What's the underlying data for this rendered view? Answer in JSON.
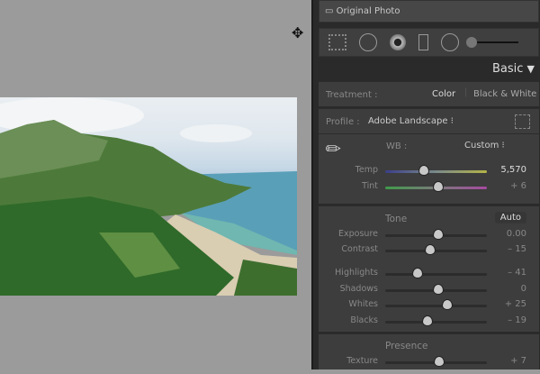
{
  "original_photo": "Original Photo",
  "panel_title": "Basic",
  "treatment": {
    "label": "Treatment :",
    "options": [
      "Color",
      "Black & White"
    ],
    "selected": "Color"
  },
  "profile": {
    "label": "Profile :",
    "value": "Adobe Landscape"
  },
  "wb": {
    "label": "WB :",
    "value": "Custom"
  },
  "sliders_wb": [
    {
      "label": "Temp",
      "value": "5,570",
      "pos": 0.38
    },
    {
      "label": "Tint",
      "value": "+ 6",
      "pos": 0.52
    }
  ],
  "tone": {
    "title": "Tone",
    "auto": "Auto"
  },
  "sliders_tone": [
    {
      "label": "Exposure",
      "value": "0.00",
      "pos": 0.52
    },
    {
      "label": "Contrast",
      "value": "– 15",
      "pos": 0.44
    }
  ],
  "sliders_tone2": [
    {
      "label": "Highlights",
      "value": "– 41",
      "pos": 0.32
    },
    {
      "label": "Shadows",
      "value": "0",
      "pos": 0.52
    },
    {
      "label": "Whites",
      "value": "+ 25",
      "pos": 0.61
    },
    {
      "label": "Blacks",
      "value": "– 19",
      "pos": 0.42
    }
  ],
  "presence": {
    "title": "Presence"
  },
  "sliders_presence": [
    {
      "label": "Texture",
      "value": "+ 7",
      "pos": 0.53
    }
  ]
}
